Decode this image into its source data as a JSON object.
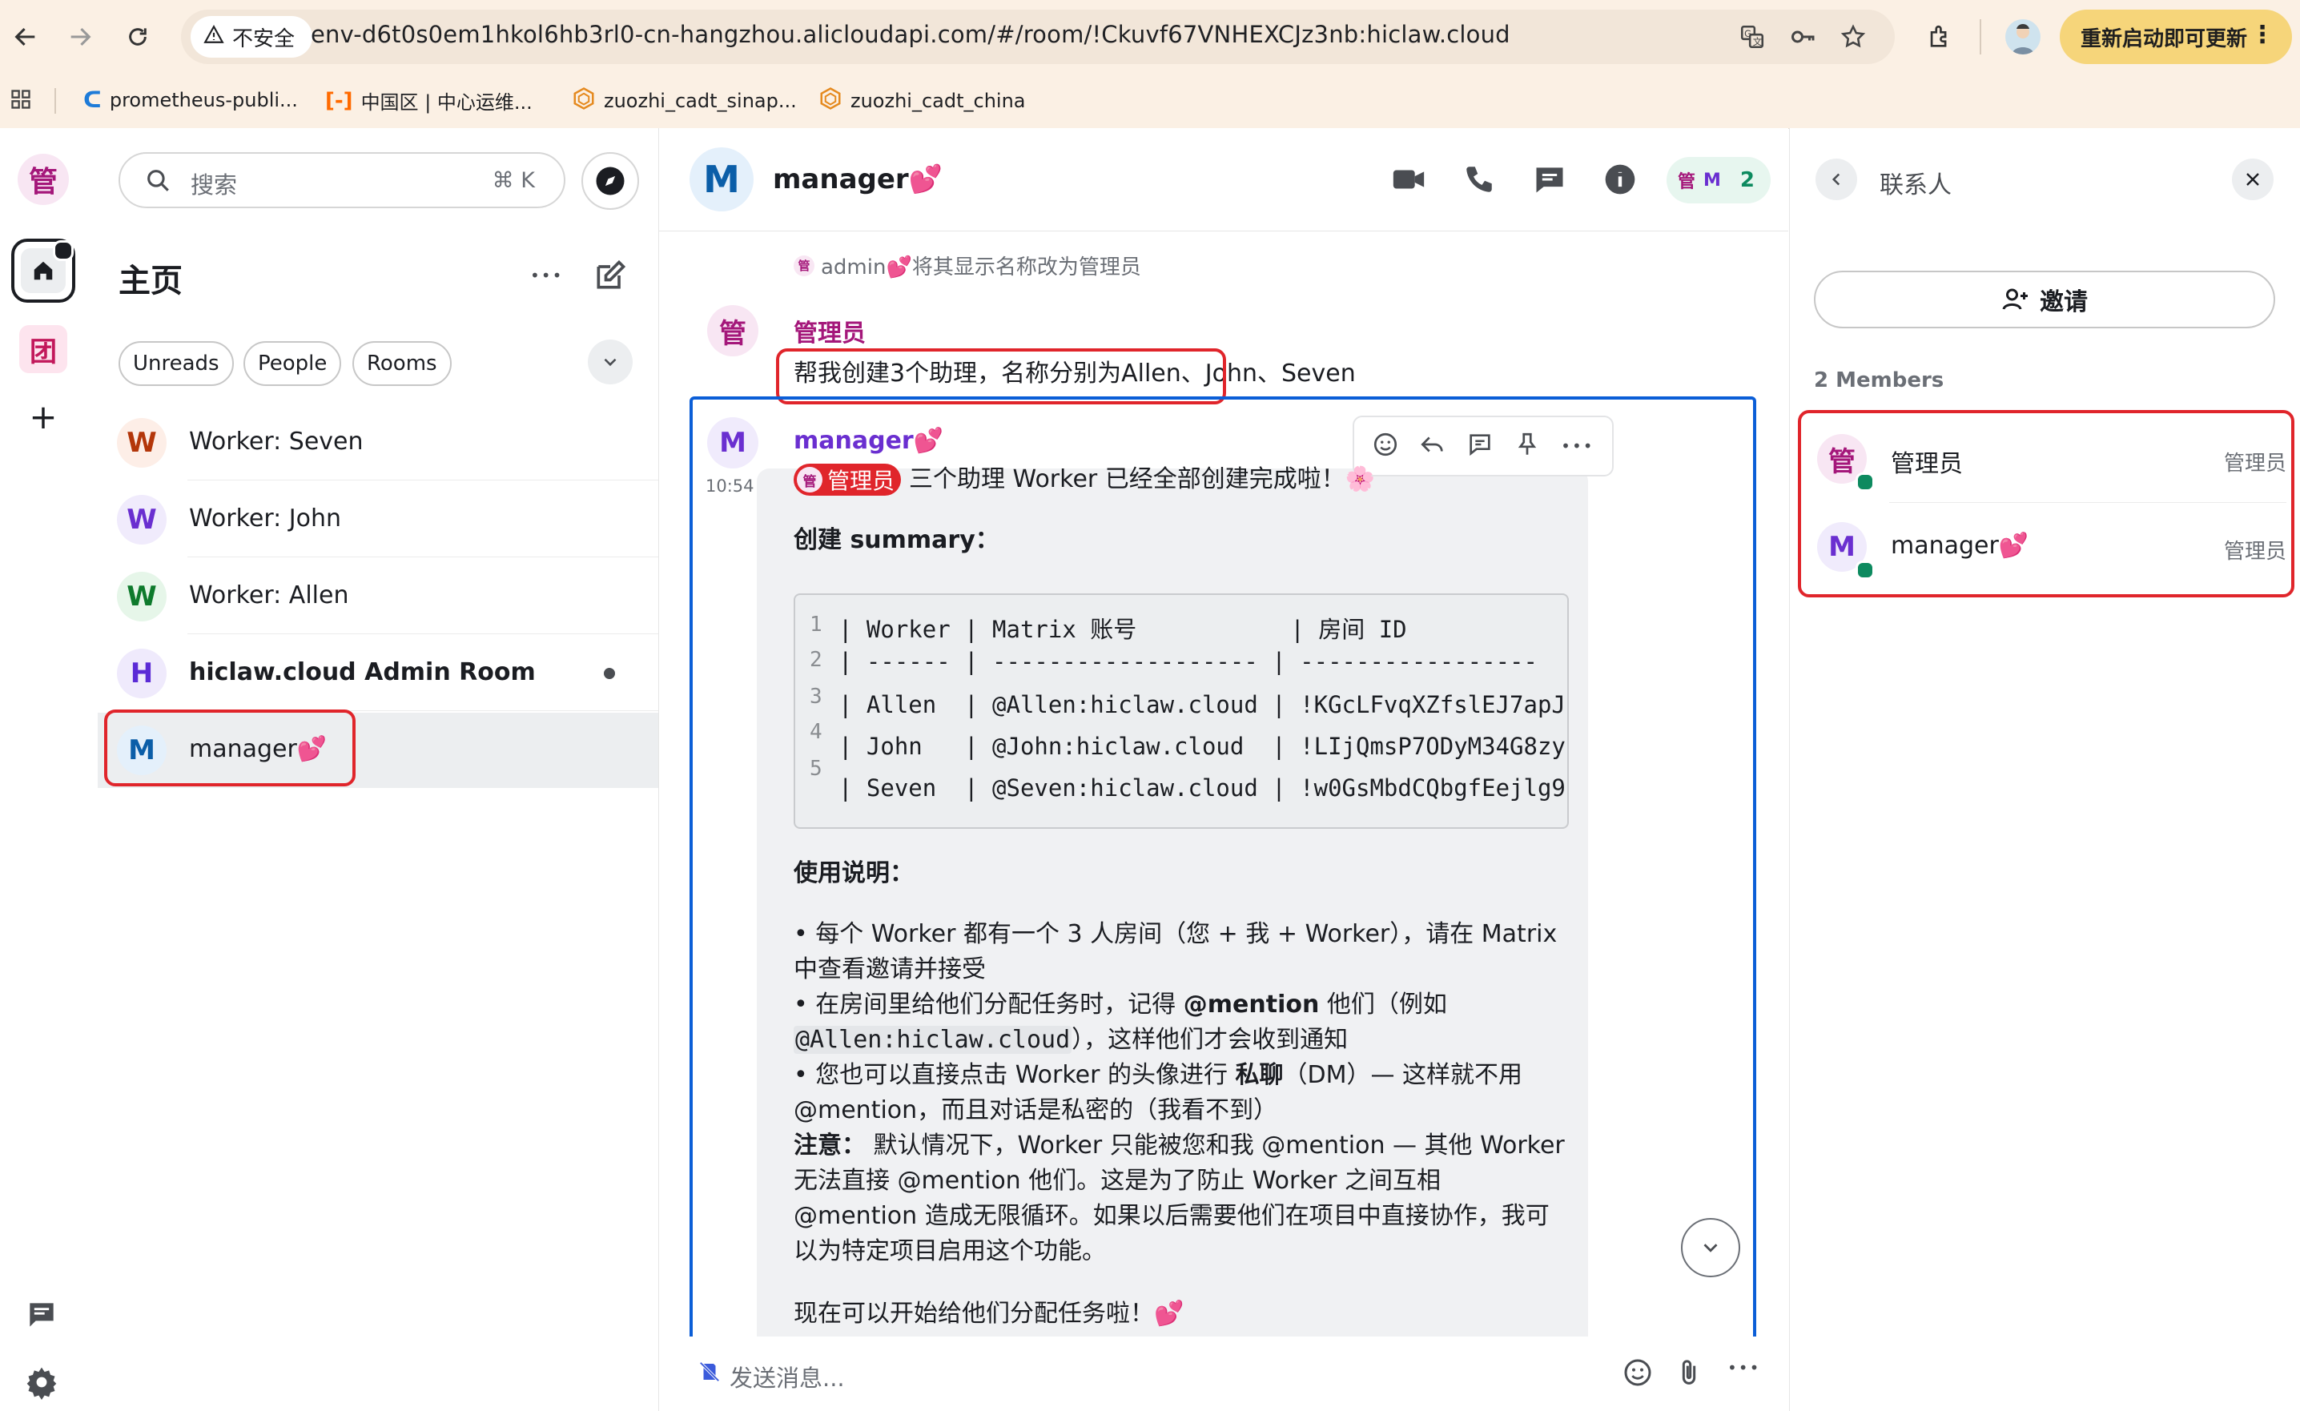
{
  "browser": {
    "security_label": "不安全",
    "url": "env-d6t0s0em1hkol6hb3rl0-cn-hangzhou.alicloudapi.com/#/room/!Ckuvf67VNHEXCJz3nb:hiclaw.cloud",
    "update_button": "重新启动即可更新",
    "bookmarks": [
      {
        "label": "prometheus-publi...",
        "icon": "prometheus-icon"
      },
      {
        "label": "中国区 | 中心运维...",
        "icon": "alicloud-icon"
      },
      {
        "label": "zuozhi_cadt_sinap...",
        "icon": "cadt-icon"
      },
      {
        "label": "zuozhi_cadt_china",
        "icon": "cadt-icon"
      }
    ]
  },
  "rail": {
    "space_avatar": "管",
    "team_avatar": "团",
    "add": "+"
  },
  "room_list": {
    "search_placeholder": "搜索",
    "search_shortcut": "⌘ K",
    "title": "主页",
    "more": "•••",
    "filters": [
      "Unreads",
      "People",
      "Rooms"
    ],
    "rooms": [
      {
        "avatar": "W",
        "name": "Worker: Seven",
        "avatar_color": "#b3360a",
        "avatar_bg": "#fdeee7"
      },
      {
        "avatar": "W",
        "name": "Worker: John",
        "avatar_color": "#6a2fd0",
        "avatar_bg": "#f0ebfc"
      },
      {
        "avatar": "W",
        "name": "Worker: Allen",
        "avatar_color": "#0e7a2c",
        "avatar_bg": "#e6f6e9"
      },
      {
        "avatar": "H",
        "name": "hiclaw.cloud Admin Room",
        "avatar_color": "#5b2bd6",
        "avatar_bg": "#efeafc",
        "unread": true
      },
      {
        "avatar": "M",
        "name": "manager",
        "emoji": "💕",
        "avatar_color": "#0b5ea8",
        "avatar_bg": "#e4f0fb",
        "selected": true
      }
    ]
  },
  "chat": {
    "room_avatar": "M",
    "room_name": "manager",
    "room_emoji": "💕",
    "facepile": [
      "管",
      "M"
    ],
    "member_count": "2",
    "timeline": {
      "state_event": {
        "avatar": "管",
        "text": "admin💕将其显示名称改为管理员"
      },
      "admin_message": {
        "avatar": "管",
        "sender": "管理员",
        "body": "帮我创建3个助理，名称分别为Allen、John、Seven"
      },
      "manager_message": {
        "avatar": "M",
        "sender": "manager",
        "sender_emoji": "💕",
        "time": "10:54",
        "mention_pill": "管理员",
        "mention_pill_avatar": "管",
        "intro": "三个助理 Worker 已经全部创建完成啦！🌸",
        "summary_heading": "创建 summary：",
        "code_line_numbers": [
          "1",
          "2",
          "3",
          "4",
          "5"
        ],
        "code_lines": [
          "| Worker | Matrix 账号           | 房间 ID",
          "| ------ | ------------------- | -----------------",
          "| Allen  | @Allen:hiclaw.cloud | !KGcLFvqXZfslEJ7apJ",
          "| John   | @John:hiclaw.cloud  | !LIjQmsP7ODyM34G8zy",
          "| Seven  | @Seven:hiclaw.cloud | !w0GsMbdCQbgfEejlg9"
        ],
        "usage_heading": "使用说明：",
        "bullet1": "• 每个 Worker 都有一个 3 人房间（您 + 我 + Worker），请在 Matrix 中查看邀请并接受",
        "bullet2_a": "• 在房间里给他们分配任务时，记得 ",
        "bullet2_b": "@mention",
        "bullet2_c": " 他们（例如",
        "bullet2_code": "@Allen:hiclaw.cloud",
        "bullet2_d": "），这样他们才会收到通知",
        "bullet3_a": "• 您也可以直接点击 Worker 的头像进行 ",
        "bullet3_b": "私聊",
        "bullet3_c": "（DM）— 这样就不用@mention，而且对话是私密的（我看不到）",
        "note_label": "注意：",
        "note_text": " 默认情况下，Worker 只能被您和我 @mention — 其他 Worker 无法直接 @mention 他们。这是为了防止 Worker 之间互相 @mention 造成无限循环。如果以后需要他们在项目中直接协作，我可以为特定项目启用这个功能。",
        "closing": "现在可以开始给他们分配任务啦！💕"
      }
    },
    "composer_placeholder": "发送消息..."
  },
  "right_panel": {
    "title": "联系人",
    "invite_label": "邀请",
    "members_count_label": "2 Members",
    "members": [
      {
        "avatar": "管",
        "name": "管理员",
        "role": "管理员",
        "avatar_color": "#a4177a",
        "avatar_bg": "#f8e6f3"
      },
      {
        "avatar": "M",
        "name": "manager",
        "emoji": "💕",
        "role": "管理员",
        "avatar_color": "#6a2fd0",
        "avatar_bg": "#f0ebfc"
      }
    ]
  },
  "colors": {
    "accent_green": "#0d8a5f",
    "highlight_red": "#e0252b",
    "admin_name": "#a4177a",
    "manager_name": "#6a2fd0",
    "bubble_bg": "#f0f1f3",
    "selected_outline": "#0b5ed7"
  }
}
